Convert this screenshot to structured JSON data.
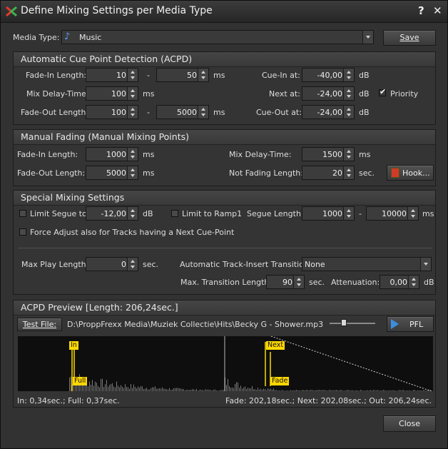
{
  "window": {
    "title": "Define Mixing Settings per Media Type",
    "help": "?",
    "close": "✕"
  },
  "media_type": {
    "label": "Media Type:",
    "value": "Music",
    "save": "Save"
  },
  "acpd": {
    "title": "Automatic Cue Point Detection (ACPD)",
    "fadein_label": "Fade-In Length:",
    "fadein_min": "10",
    "fadein_max": "50",
    "ms": "ms",
    "dash": "-",
    "mixdelay_label": "Mix Delay-Time:",
    "mixdelay": "100",
    "fadeout_label": "Fade-Out Length:",
    "fadeout_min": "100",
    "fadeout_max": "5000",
    "cuein_label": "Cue-In at:",
    "cuein": "-40,00",
    "next_label": "Next at:",
    "next": "-24,00",
    "cueout_label": "Cue-Out at:",
    "cueout": "-24,00",
    "db": "dB",
    "priority_label": "Priority",
    "priority_checked": true
  },
  "manual": {
    "title": "Manual Fading (Manual Mixing Points)",
    "fadein_label": "Fade-In Length:",
    "fadein": "1000",
    "fadeout_label": "Fade-Out Length:",
    "fadeout": "5000",
    "mixdelay_label": "Mix Delay-Time:",
    "mixdelay": "1500",
    "notfading_label": "Not Fading Length:",
    "notfading": "20",
    "ms": "ms",
    "sec": "sec.",
    "hook": "Hook..."
  },
  "special": {
    "title": "Special Mixing Settings",
    "limit_segue_label": "Limit Segue to:",
    "limit_segue": "-12,00",
    "db": "dB",
    "limit_ramp_label": "Limit to Ramp1",
    "segue_len_label": "Segue Length:",
    "segue_min": "1000",
    "segue_max": "10000",
    "ms": "ms",
    "dash": "-",
    "force_label": "Force Adjust also for Tracks having a Next Cue-Point",
    "maxplay_label": "Max Play Length:",
    "maxplay": "0",
    "sec": "sec.",
    "transition_label": "Automatic Track-Insert Transition:",
    "transition": "None",
    "maxtrans_label": "Max. Transition Length:",
    "maxtrans": "90",
    "atten_label": "Attenuation:",
    "atten": "0,00"
  },
  "preview": {
    "title": "ACPD Preview [Length: 206,24sec.]",
    "testfile": "Test File:",
    "path": "D:\\ProppFrexx Media\\Muziek Collectie\\Hits\\Becky G - Shower.mp3",
    "pfl": "PFL",
    "volume_level": 0.28,
    "marker_in": "In",
    "marker_full": "Full",
    "marker_next": "Next",
    "marker_fade": "Fade",
    "status_left": "In: 0,34sec.; Full: 0,37sec.",
    "status_right": "Fade: 202,18sec.; Next: 202,08sec.; Out: 206,24sec."
  },
  "footer": {
    "close": "Close"
  },
  "colors": {
    "marker": "#ffd800",
    "wave": "#7a7a7a"
  }
}
